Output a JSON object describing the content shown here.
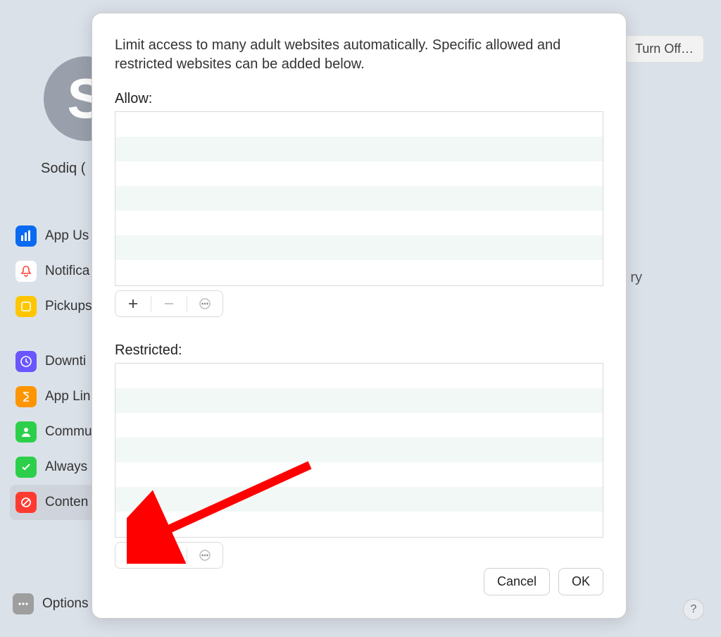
{
  "background": {
    "turn_off_label": "Turn Off…",
    "partial_text_right": "ry",
    "avatar_letter": "S",
    "username": "Sodiq (",
    "options_label": "Options",
    "help_label": "?"
  },
  "sidebar": {
    "items": [
      {
        "label": "App Us",
        "icon": "bars",
        "color": "#0b6af2"
      },
      {
        "label": "Notifica",
        "icon": "bell",
        "color": "#ff4438"
      },
      {
        "label": "Pickups",
        "icon": "pickup",
        "color": "#ffc600"
      }
    ],
    "items2": [
      {
        "label": "Downti",
        "icon": "clock",
        "color": "#6a55ff"
      },
      {
        "label": "App Lin",
        "icon": "hourglass",
        "color": "#ff9500"
      },
      {
        "label": "Commu",
        "icon": "person",
        "color": "#2dcf4a"
      },
      {
        "label": "Always",
        "icon": "check",
        "color": "#2dcf4a"
      },
      {
        "label": "Conten",
        "icon": "nosign",
        "color": "#ff3b30",
        "selected": true
      }
    ]
  },
  "dialog": {
    "description": "Limit access to many adult websites automatically. Specific allowed and restricted websites can be added below.",
    "allow_label": "Allow:",
    "restricted_label": "Restricted:",
    "cancel_label": "Cancel",
    "ok_label": "OK"
  }
}
